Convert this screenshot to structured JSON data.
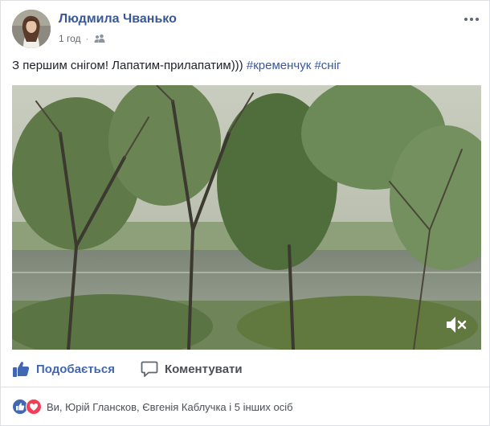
{
  "post": {
    "author": "Людмила Чванько",
    "time": "1 год",
    "separator": "·",
    "text_prefix": "З першим снігом! Лапатим-прилапатим)))",
    "hashtags": [
      "#кременчук",
      "#сніг"
    ]
  },
  "actions": {
    "like_label": "Подобається",
    "comment_label": "Коментувати"
  },
  "reactions": {
    "summary": "Ви, Юрій Глансков, Євгенія Каблучка і 5 інших осіб"
  },
  "colors": {
    "link_blue": "#385898",
    "like_blue": "#4267b2",
    "love_red": "#f33e58",
    "text_gray": "#4b4f56"
  },
  "icons": {
    "more": "more-horizontal-icon",
    "audience": "friends-audience-icon",
    "like": "thumbs-up-icon",
    "comment": "comment-bubble-icon",
    "mute": "muted-speaker-icon",
    "reaction_like": "like-reaction-icon",
    "reaction_love": "love-reaction-icon"
  }
}
